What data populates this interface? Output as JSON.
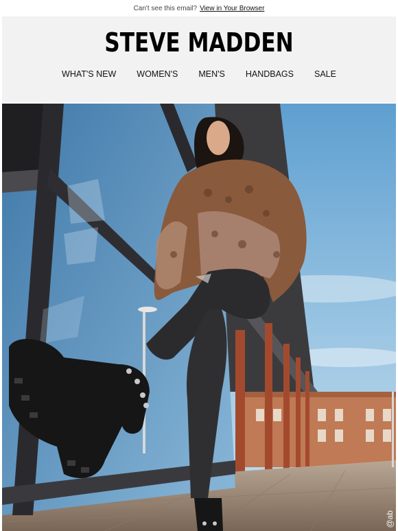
{
  "preheader": {
    "text": "Can't see this email?",
    "link": "View in Your Browser"
  },
  "brand": {
    "logo": "STEVE MADDEN"
  },
  "nav": [
    {
      "label": "WHAT'S NEW"
    },
    {
      "label": "WOMEN'S"
    },
    {
      "label": "MEN'S"
    },
    {
      "label": "HANDBAGS"
    },
    {
      "label": "SALE"
    }
  ],
  "hero": {
    "credit": "@ab"
  },
  "colors": {
    "header_bg": "#f2f2f2",
    "sky": "#7fb2d9",
    "jacket_brown": "#8a5a3c",
    "jeans": "#2b2b2d",
    "brick": "#b45a3a"
  }
}
